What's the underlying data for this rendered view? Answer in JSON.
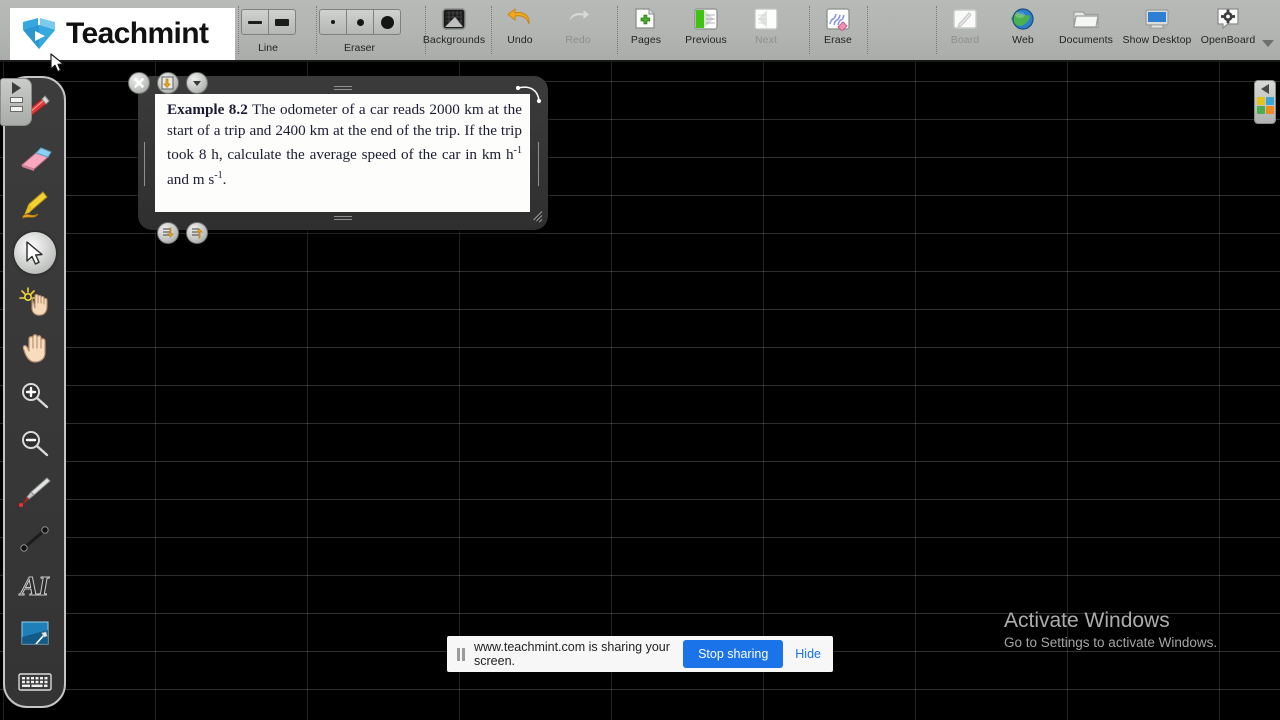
{
  "app": {
    "name": "OpenBoard",
    "brand": "Teachmint"
  },
  "toolbar": {
    "groups": [
      {
        "name": "line-width",
        "label": "Line",
        "options": [
          "thin-line",
          "thick-line"
        ]
      },
      {
        "name": "eraser-width",
        "label": "Eraser",
        "options": [
          "small-dot",
          "medium-dot",
          "large-dot"
        ]
      }
    ],
    "items": [
      {
        "name": "backgrounds",
        "label": "Backgrounds",
        "enabled": true
      },
      {
        "name": "undo",
        "label": "Undo",
        "enabled": true
      },
      {
        "name": "redo",
        "label": "Redo",
        "enabled": false
      },
      {
        "name": "pages",
        "label": "Pages",
        "enabled": true
      },
      {
        "name": "previous",
        "label": "Previous",
        "enabled": true
      },
      {
        "name": "next",
        "label": "Next",
        "enabled": false
      },
      {
        "name": "erase",
        "label": "Erase",
        "enabled": true
      }
    ],
    "right_items": [
      {
        "name": "board",
        "label": "Board",
        "enabled": false
      },
      {
        "name": "web",
        "label": "Web",
        "enabled": true
      },
      {
        "name": "documents",
        "label": "Documents",
        "enabled": true
      },
      {
        "name": "show-desktop",
        "label": "Show Desktop",
        "enabled": true
      },
      {
        "name": "openboard",
        "label": "OpenBoard",
        "enabled": true
      }
    ]
  },
  "palette": {
    "tools": [
      {
        "name": "pen",
        "label": "Pen"
      },
      {
        "name": "eraser",
        "label": "Eraser"
      },
      {
        "name": "marker",
        "label": "Highlighter"
      },
      {
        "name": "selector",
        "label": "Select",
        "selected": true
      },
      {
        "name": "interact",
        "label": "Interact"
      },
      {
        "name": "hand",
        "label": "Hand / Pan"
      },
      {
        "name": "zoom-in",
        "label": "Zoom In"
      },
      {
        "name": "zoom-out",
        "label": "Zoom Out"
      },
      {
        "name": "laser-pointer",
        "label": "Laser Pointer"
      },
      {
        "name": "line",
        "label": "Line"
      },
      {
        "name": "text",
        "label": "Text"
      },
      {
        "name": "capture",
        "label": "Capture Area"
      },
      {
        "name": "virtual-keyboard",
        "label": "Virtual Keyboard"
      }
    ]
  },
  "note": {
    "example_label": "Example 8.2",
    "text": "The odometer of a car reads 2000 km at the start of a trip and 2400 km at the end of the trip. If the trip took 8 h, calculate the average speed of the car in km h",
    "sup1": "-1",
    "text_mid": " and m s",
    "sup2": "-1",
    "text_end": ".",
    "buttons": [
      {
        "name": "close",
        "label": "Close"
      },
      {
        "name": "duplicate",
        "label": "Duplicate"
      },
      {
        "name": "menu",
        "label": "Menu"
      },
      {
        "name": "layer-down",
        "label": "Send Backward"
      },
      {
        "name": "layer-up",
        "label": "Bring Forward"
      }
    ]
  },
  "watermark": {
    "title": "Activate Windows",
    "subtitle": "Go to Settings to activate Windows."
  },
  "share_bar": {
    "message": "www.teachmint.com is sharing your screen.",
    "stop_label": "Stop sharing",
    "hide_label": "Hide"
  },
  "colors": {
    "toolbar_bg": "#b2b5b2",
    "canvas_bg": "#000000",
    "accent_blue": "#1a73e8",
    "brand_blue": "#35a8e0",
    "note_paper": "#fdfdfb",
    "note_frame": "#353535"
  }
}
